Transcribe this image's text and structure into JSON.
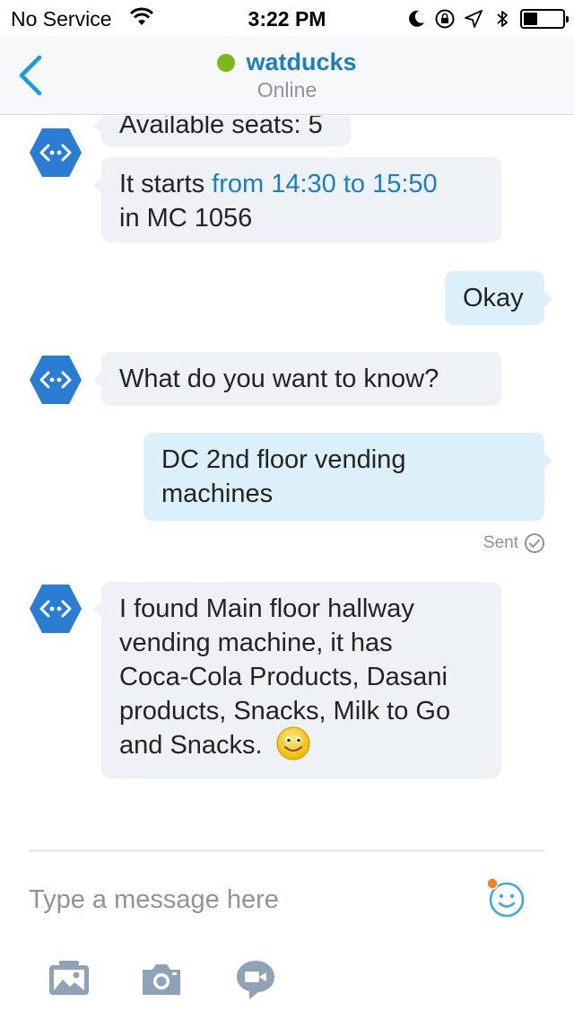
{
  "status_bar": {
    "carrier": "No Service",
    "time": "3:22 PM",
    "battery_level": 0.35
  },
  "header": {
    "contact_name": "watducks",
    "contact_status": "Online",
    "presence_color": "#7cb81e"
  },
  "messages": [
    {
      "sender": "bot",
      "text": "Available seats: 5"
    },
    {
      "sender": "bot",
      "text_prefix": "It starts ",
      "highlight": "from 14:30 to 15:50",
      "text_suffix": "in MC 1056"
    },
    {
      "sender": "user",
      "text": "Okay"
    },
    {
      "sender": "bot",
      "text": "What do you want to know?"
    },
    {
      "sender": "user",
      "line1": "DC 2nd floor vending",
      "line2": "machines"
    },
    {
      "sender": "bot",
      "lines": [
        "I found Main floor hallway",
        "vending machine, it has",
        "Coca-Cola Products, Dasani",
        "products, Snacks, Milk to Go",
        "and Snacks."
      ],
      "emoticon": "smile-emoticon"
    }
  ],
  "sent_label": "Sent",
  "composer": {
    "placeholder": "Type a message here"
  },
  "colors": {
    "accent": "#1a7fc1",
    "bot_avatar": "#2b7cd3",
    "incoming_bubble": "#eef1f5",
    "outgoing_bubble": "#dcf0fb",
    "toolbar_icon": "#8fa3b8",
    "notification_dot": "#f5821f"
  },
  "toolbar_icons": [
    "photo-icon",
    "camera-icon",
    "video-message-icon"
  ]
}
